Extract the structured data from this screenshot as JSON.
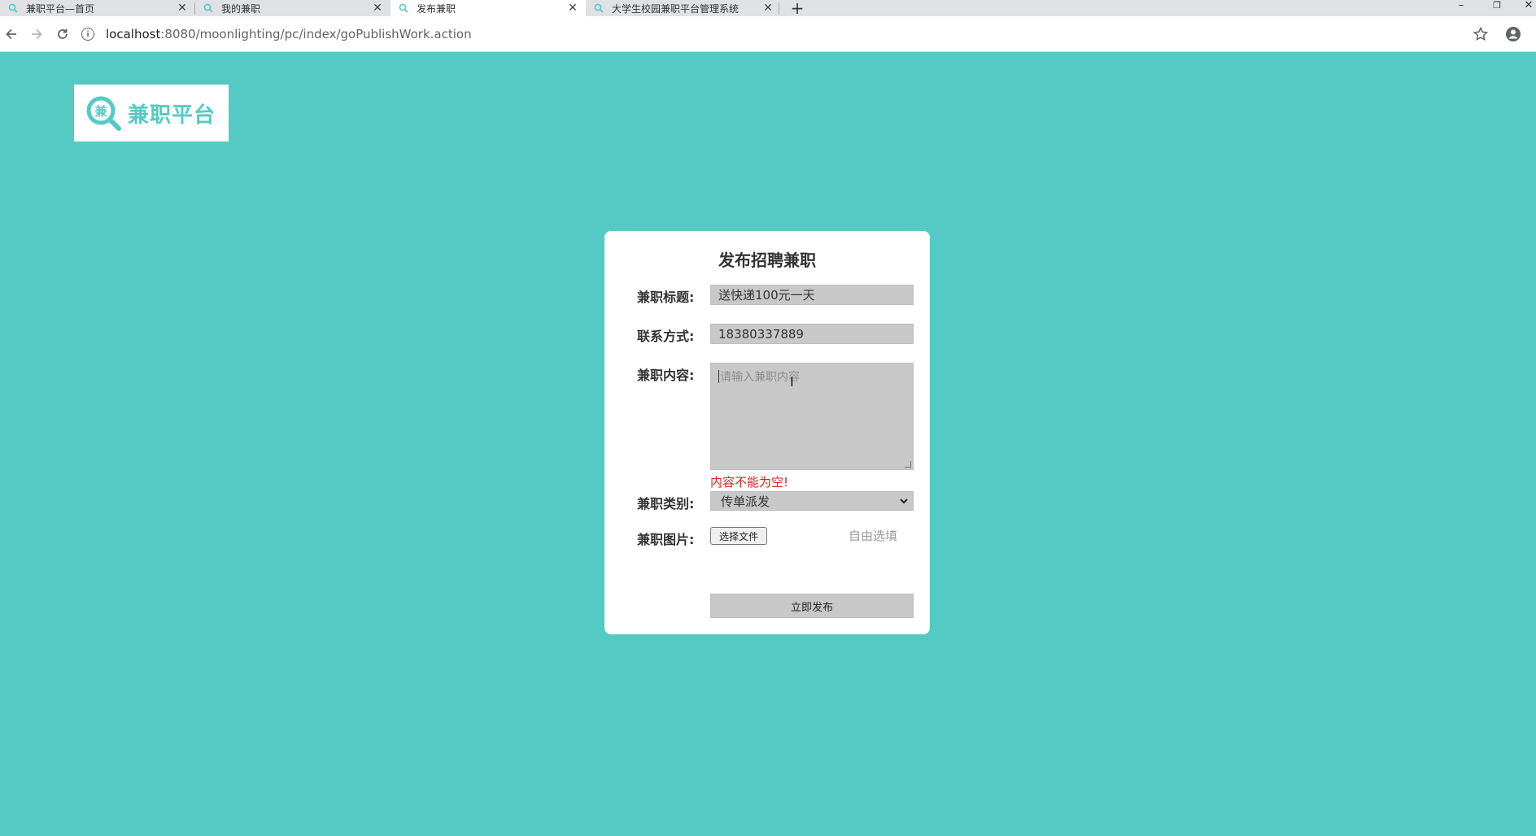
{
  "browser": {
    "tabs": [
      {
        "title": "兼职平台—首页",
        "active": false
      },
      {
        "title": "我的兼职",
        "active": false
      },
      {
        "title": "发布兼职",
        "active": true
      },
      {
        "title": "大学生校园兼职平台管理系统",
        "active": false
      }
    ],
    "new_tab_label": "+",
    "url_host": "localhost",
    "url_path": ":8080/moonlighting/pc/index/goPublishWork.action"
  },
  "logo": {
    "text": "兼职平台",
    "mark_char": "兼"
  },
  "form": {
    "title": "发布招聘兼职",
    "job_title_label": "兼职标题:",
    "job_title_value": "送快递100元一天",
    "contact_label": "联系方式:",
    "contact_value": "18380337889",
    "content_label": "兼职内容:",
    "content_placeholder": "请输入兼职内容",
    "content_error": "内容不能为空!",
    "category_label": "兼职类别:",
    "category_selected": "传单派发",
    "image_label": "兼职图片:",
    "choose_file_label": "选择文件",
    "image_hint": "自由选填",
    "submit_label": "立即发布"
  },
  "colors": {
    "page_background": "#53cbc4",
    "field_background": "#c8c8c8",
    "error": "#e02020"
  }
}
